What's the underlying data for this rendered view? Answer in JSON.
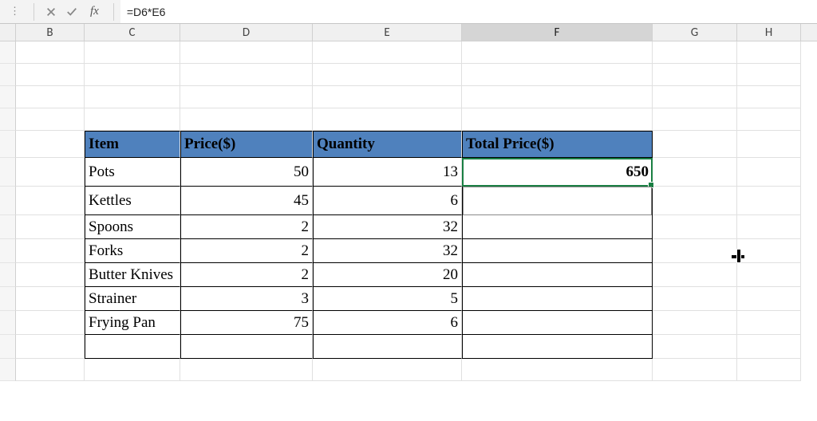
{
  "formula_bar": {
    "fx_label": "fx",
    "formula": "=D6*E6"
  },
  "columns": {
    "B": "B",
    "C": "C",
    "D": "D",
    "E": "E",
    "F": "F",
    "G": "G",
    "H": "H"
  },
  "selected_col": "F",
  "table": {
    "headers": {
      "item": "Item",
      "price": "Price($)",
      "qty": "Quantity",
      "total": "Total Price($)"
    },
    "rows": [
      {
        "item": "Pots",
        "price": "50",
        "qty": "13",
        "total": "650"
      },
      {
        "item": "Kettles",
        "price": "45",
        "qty": "6",
        "total": ""
      },
      {
        "item": "Spoons",
        "price": "2",
        "qty": "32",
        "total": ""
      },
      {
        "item": "Forks",
        "price": "2",
        "qty": "32",
        "total": ""
      },
      {
        "item": "Butter Knives",
        "price": "2",
        "qty": "20",
        "total": ""
      },
      {
        "item": "Strainer",
        "price": "3",
        "qty": "5",
        "total": ""
      },
      {
        "item": "Frying Pan",
        "price": "75",
        "qty": "6",
        "total": ""
      }
    ]
  },
  "chart_data": {
    "type": "table",
    "title": "",
    "columns": [
      "Item",
      "Price($)",
      "Quantity",
      "Total Price($)"
    ],
    "rows": [
      [
        "Pots",
        50,
        13,
        650
      ],
      [
        "Kettles",
        45,
        6,
        null
      ],
      [
        "Spoons",
        2,
        32,
        null
      ],
      [
        "Forks",
        2,
        32,
        null
      ],
      [
        "Butter Knives",
        2,
        20,
        null
      ],
      [
        "Strainer",
        3,
        5,
        null
      ],
      [
        "Frying Pan",
        75,
        6,
        null
      ]
    ]
  }
}
